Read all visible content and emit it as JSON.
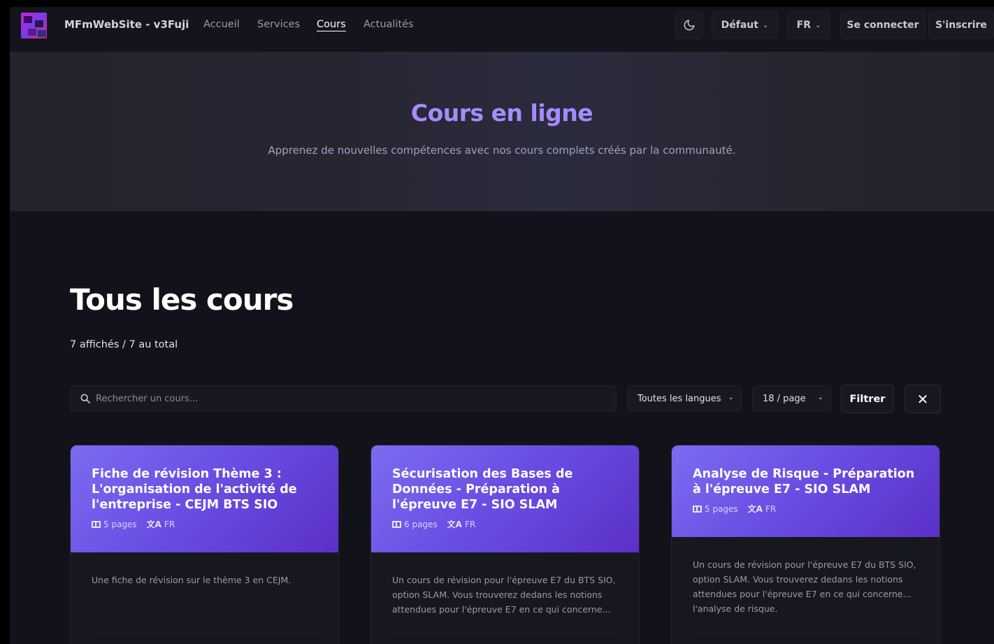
{
  "navbar": {
    "brand": "MFmWebSite - v3Fuji",
    "links": [
      {
        "label": "Accueil",
        "active": false
      },
      {
        "label": "Services",
        "active": false
      },
      {
        "label": "Cours",
        "active": true
      },
      {
        "label": "Actualités",
        "active": false
      }
    ],
    "theme_icon": "moon-icon",
    "theme_select": "Défaut",
    "language_select": "FR",
    "login_label": "Se connecter",
    "register_label": "S'inscrire"
  },
  "hero": {
    "title": "Cours en ligne",
    "subtitle": "Apprenez de nouvelles compétences avec nos cours complets créés par la communauté."
  },
  "main": {
    "title": "Tous les cours",
    "count": "7 affichés / 7 au total",
    "search": {
      "placeholder": "Rechercher un cours...",
      "value": ""
    },
    "language_filter": "Toutes les langues",
    "per_page": "18 / page",
    "filter_label": "Filtrer",
    "clear_label": "✕"
  },
  "courses": [
    {
      "title": "Fiche de révision Thème 3 : L'organisation de l'activité de l'entreprise - CEJM BTS SIO",
      "pages": "5 pages",
      "lang": "FR",
      "description": "Une fiche de révision sur le thème 3 en CEJM."
    },
    {
      "title": "Sécurisation des Bases de Données - Préparation à l'épreuve E7 - SIO SLAM",
      "pages": "6 pages",
      "lang": "FR",
      "description": "Un cours de révision pour l'épreuve E7 du BTS SIO, option SLAM. Vous trouverez dedans les notions attendues pour l'épreuve E7 en ce qui concerne..."
    },
    {
      "title": "Analyse de Risque - Préparation à l'épreuve E7 - SIO SLAM",
      "pages": "5 pages",
      "lang": "FR",
      "description": "Un cours de révision pour l'épreuve E7 du BTS SIO, option SLAM. Vous trouverez dedans les notions attendues pour l'épreuve E7 en ce qui concerne... l'analyse de risque."
    }
  ],
  "colors": {
    "accent": "#a78bfa",
    "card_gradient_start": "#7c6cf0",
    "card_gradient_end": "#5b30c9",
    "background": "#12121a"
  }
}
